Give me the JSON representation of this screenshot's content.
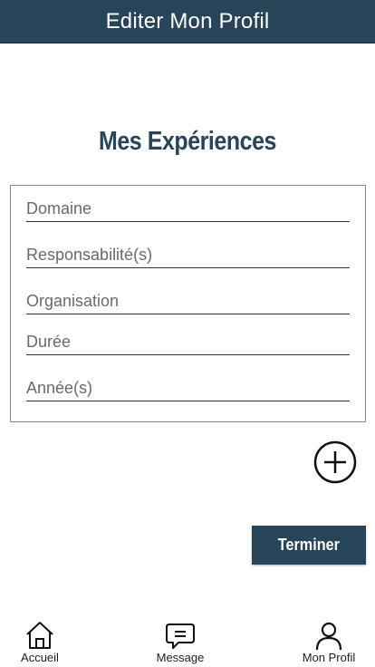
{
  "header": {
    "title": "Editer Mon Profil"
  },
  "section": {
    "title": "Mes Expériences"
  },
  "form": {
    "fields": [
      {
        "placeholder": "Domaine",
        "value": ""
      },
      {
        "placeholder": "Responsabilité(s)",
        "value": ""
      },
      {
        "placeholder": "Organisation",
        "value": ""
      },
      {
        "placeholder": "Durée",
        "value": ""
      },
      {
        "placeholder": "Année(s)",
        "value": ""
      }
    ]
  },
  "actions": {
    "add_icon": "plus-circle-icon",
    "finish_label": "Terminer"
  },
  "nav": {
    "items": [
      {
        "label": "Accueil",
        "icon": "home-icon"
      },
      {
        "label": "Message",
        "icon": "message-icon"
      },
      {
        "label": "Mon Profil",
        "icon": "user-icon"
      }
    ]
  },
  "colors": {
    "primary": "#274459",
    "background": "#ffffff"
  }
}
